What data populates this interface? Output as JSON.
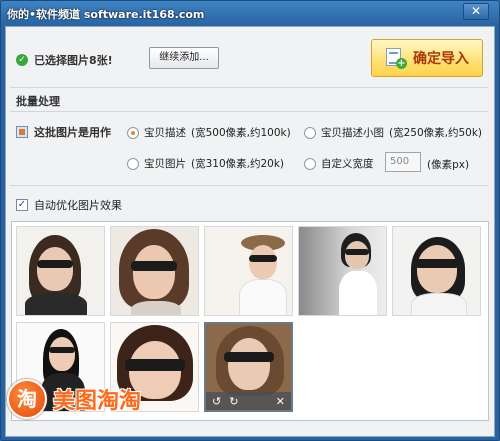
{
  "window": {
    "title": "你的•软件频道 software.it168.com",
    "close_glyph": "✕"
  },
  "status": {
    "text": "已选择图片8张!"
  },
  "buttons": {
    "add_more": "继续添加...",
    "confirm_import": "确定导入"
  },
  "batch": {
    "title": "批量处理",
    "usage_label": "这批图片是用作",
    "options": [
      {
        "label": "宝贝描述",
        "note": "(宽500像素,约100k)",
        "checked": true
      },
      {
        "label": "宝贝描述小图",
        "note": "(宽250像素,约50k)",
        "checked": false
      },
      {
        "label": "宝贝图片",
        "note": "(宽310像素,约20k)",
        "checked": false
      },
      {
        "label": "自定义宽度",
        "note": "",
        "checked": false
      }
    ],
    "custom_width_value": "500",
    "unit_label": "(像素px)"
  },
  "auto_optimize": {
    "label": "自动优化图片效果",
    "checked": true
  },
  "gallery": {
    "count": 8,
    "toolbar": {
      "rotate_left": "↺",
      "rotate_right": "↻",
      "delete": "✕"
    }
  },
  "logo": {
    "mark": "淘",
    "text": "美图淘淘"
  },
  "colors": {
    "accent": "#e38a20",
    "import_text": "#a83a08",
    "check_green": "#3aa63a",
    "logo_orange": "#ff6a1a"
  }
}
